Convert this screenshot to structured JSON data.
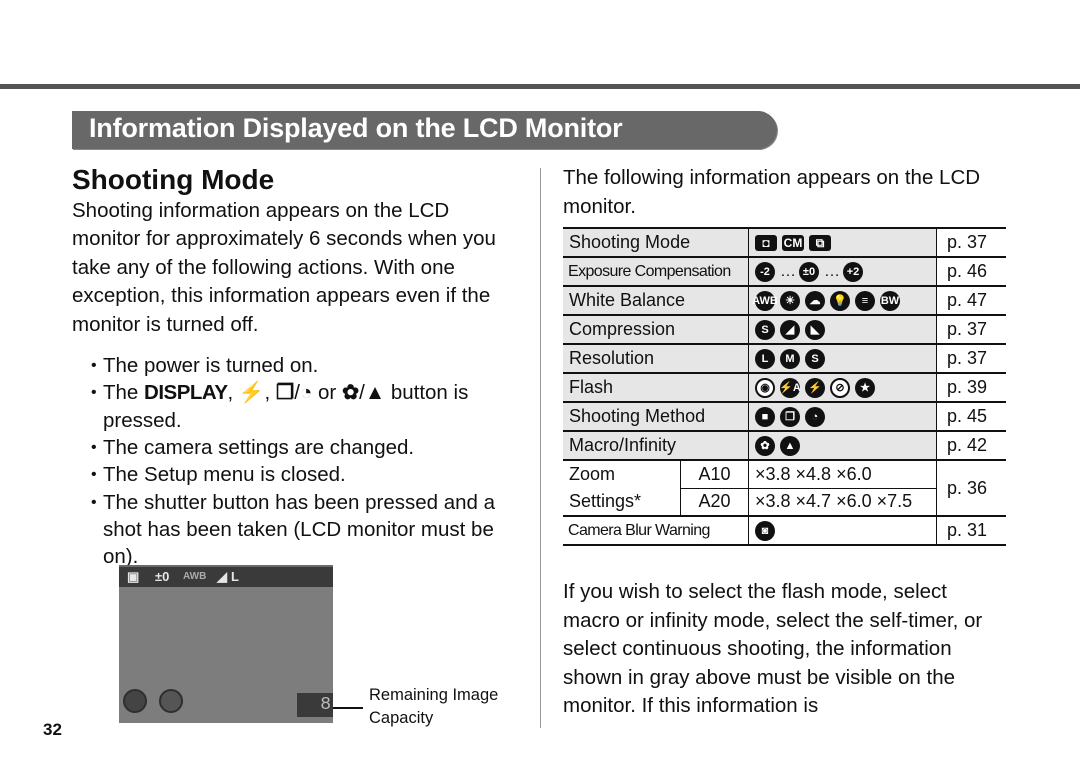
{
  "section_title": "Information Displayed on the LCD Monitor",
  "page_number": "32",
  "left": {
    "heading": "Shooting Mode",
    "intro": "Shooting information appears on the LCD monitor for approximately 6 seconds when you take any of the following actions. With one exception, this information appears even if the monitor is turned off.",
    "actions": [
      "The power is turned on.",
      {
        "prefix": "The ",
        "display_key": "DISPLAY",
        "sep1": ", ",
        "flash_glyph": "⚡",
        "sep2": ", ",
        "continuous_glyph": "❐",
        "slash1": "/",
        "selftimer_glyph": "◔",
        "or": " or ",
        "macro_glyph": "✿",
        "slash2": "/",
        "infinity_glyph": "▲",
        "suffix": " button is pressed."
      },
      "The camera settings are changed.",
      "The Setup menu is closed.",
      "The shutter button has been pressed and a shot has been taken (LCD monitor must be on)."
    ],
    "lcd_preview": {
      "top_icons": [
        "camera-mode-icon",
        "exposure-zero-icon",
        "awb-icon",
        "compression-icon",
        "resolution-L-icon"
      ],
      "top_labels": [
        "▣",
        "±0",
        "AWB",
        "◢",
        "L"
      ],
      "bottom_icons": [
        "flash-icon",
        "single-shot-icon"
      ],
      "bottom_labels": [
        "⚡",
        "▣"
      ],
      "capacity_readout": "8",
      "callout": "Remaining Image Capacity"
    }
  },
  "right": {
    "intro": "The following information appears on the LCD monitor.",
    "table": [
      {
        "label": "Shooting Mode",
        "icons": [
          {
            "name": "auto-mode-icon",
            "glyph": "◘",
            "shape": "sq"
          },
          {
            "name": "manual-mode-icon",
            "glyph": "CM",
            "shape": "sq"
          },
          {
            "name": "stitch-assist-icon",
            "glyph": "⧉",
            "shape": "sq"
          }
        ],
        "page": "p. 37",
        "gray": true
      },
      {
        "label": "Exposure Compensation",
        "icons": [
          {
            "name": "exposure-minus2-icon",
            "glyph": "-2"
          },
          {
            "name": "dots",
            "glyph": "…"
          },
          {
            "name": "exposure-zero-icon",
            "glyph": "±0"
          },
          {
            "name": "dots",
            "glyph": "…"
          },
          {
            "name": "exposure-plus2-icon",
            "glyph": "+2"
          }
        ],
        "page": "p. 46",
        "gray": true,
        "narrow": true
      },
      {
        "label": "White Balance",
        "icons": [
          {
            "name": "awb-icon",
            "glyph": "AWB"
          },
          {
            "name": "daylight-icon",
            "glyph": "☀"
          },
          {
            "name": "cloudy-icon",
            "glyph": "☁"
          },
          {
            "name": "tungsten-icon",
            "glyph": "💡"
          },
          {
            "name": "fluorescent-icon",
            "glyph": "≡"
          },
          {
            "name": "black-white-icon",
            "glyph": "BW"
          }
        ],
        "page": "p. 47",
        "gray": true
      },
      {
        "label": "Compression",
        "icons": [
          {
            "name": "superfine-icon",
            "glyph": "S"
          },
          {
            "name": "fine-icon",
            "glyph": "◢"
          },
          {
            "name": "normal-icon",
            "glyph": "◣"
          }
        ],
        "page": "p. 37",
        "gray": true
      },
      {
        "label": "Resolution",
        "icons": [
          {
            "name": "resolution-large-icon",
            "glyph": "L"
          },
          {
            "name": "resolution-medium-icon",
            "glyph": "M"
          },
          {
            "name": "resolution-small-icon",
            "glyph": "S"
          }
        ],
        "page": "p. 37",
        "gray": true
      },
      {
        "label": "Flash",
        "icons": [
          {
            "name": "red-eye-icon",
            "glyph": "◉",
            "outline": true
          },
          {
            "name": "auto-flash-icon",
            "glyph": "⚡A"
          },
          {
            "name": "flash-on-icon",
            "glyph": "⚡"
          },
          {
            "name": "flash-off-icon",
            "glyph": "⊘",
            "outline": true
          },
          {
            "name": "slow-sync-icon",
            "glyph": "★"
          }
        ],
        "page": "p. 39",
        "gray": true
      },
      {
        "label": "Shooting Method",
        "icons": [
          {
            "name": "single-shot-icon",
            "glyph": "■"
          },
          {
            "name": "continuous-icon",
            "glyph": "❐"
          },
          {
            "name": "self-timer-icon",
            "glyph": "◔"
          }
        ],
        "page": "p. 45",
        "gray": true
      },
      {
        "label": "Macro/Infinity",
        "icons": [
          {
            "name": "macro-icon",
            "glyph": "✿"
          },
          {
            "name": "infinity-icon",
            "glyph": "▲"
          }
        ],
        "page": "p. 42",
        "gray": true
      }
    ],
    "zoom_settings": {
      "label_line1": "Zoom",
      "label_line2": "Settings*",
      "rows": [
        {
          "model": "A10",
          "values": "×3.8 ×4.8 ×6.0"
        },
        {
          "model": "A20",
          "values": "×3.8 ×4.7 ×6.0 ×7.5"
        }
      ],
      "page": "p. 36"
    },
    "blur_warning": {
      "label": "Camera Blur Warning",
      "icon_name": "camera-shake-icon",
      "glyph": "◙",
      "page": "p. 31"
    },
    "outro": "If you wish to select the flash mode, select macro or infinity mode, select the self-timer, or select continuous shooting, the information shown in gray above must be visible on the monitor. If this information is"
  }
}
